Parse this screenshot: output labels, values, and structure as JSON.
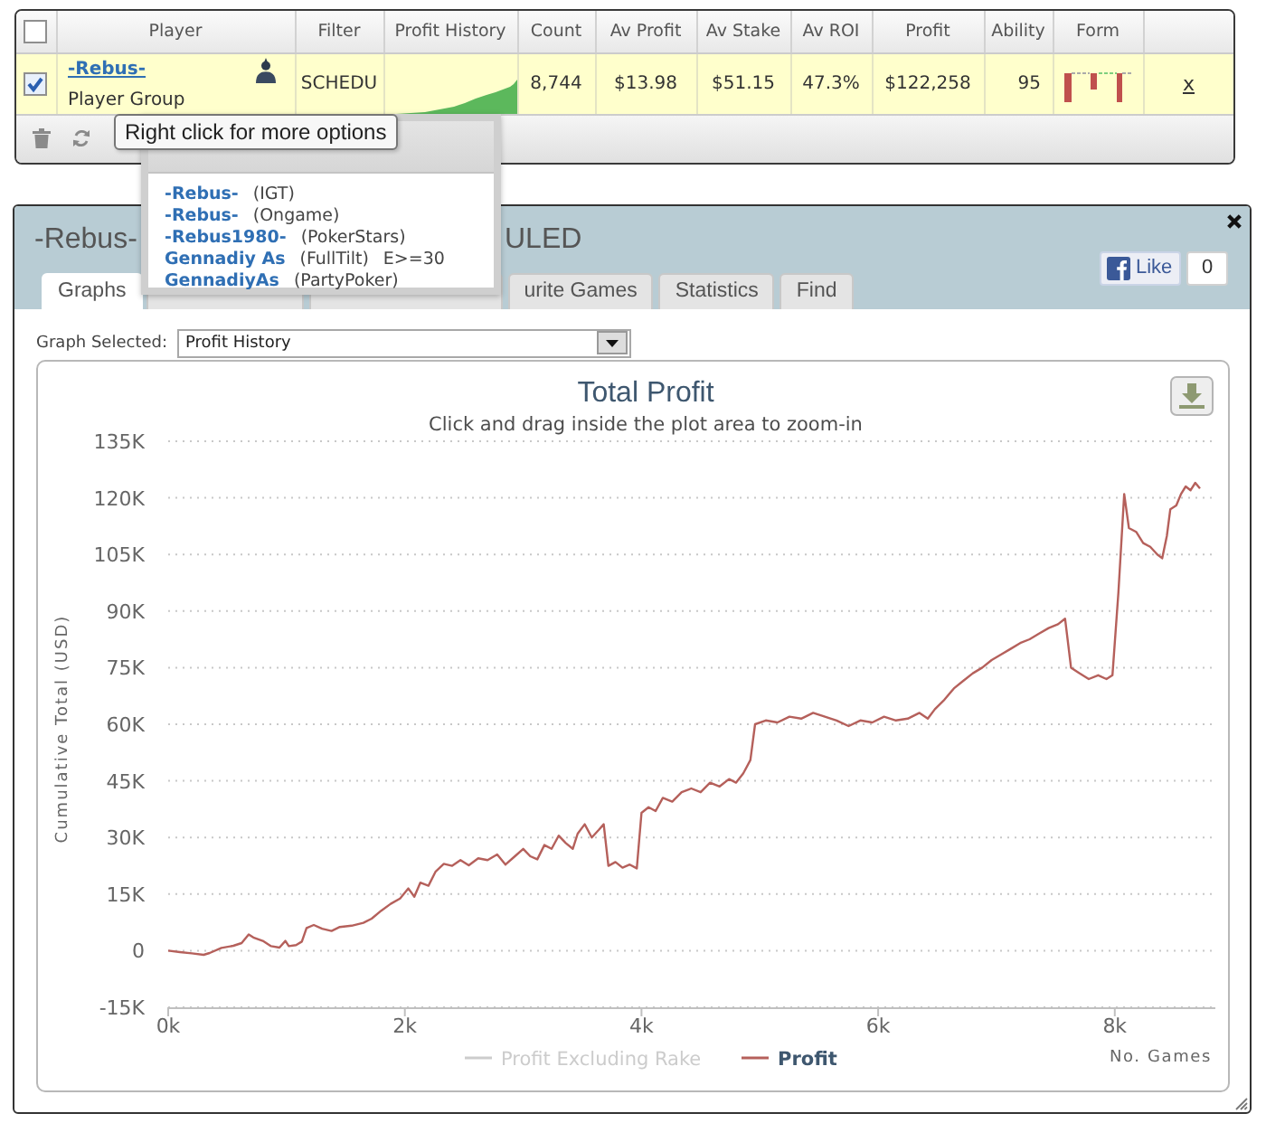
{
  "players_table": {
    "select_all_checked": false,
    "columns": [
      "Player",
      "Filter",
      "Profit History",
      "Count",
      "Av Profit",
      "Av Stake",
      "Av ROI",
      "Profit",
      "Ability",
      "Form"
    ],
    "rows": [
      {
        "checked": true,
        "player": "-Rebus-",
        "group": "Player Group",
        "filter": "SCHEDU",
        "count": "8,744",
        "av_profit": "$13.98",
        "av_stake": "$51.15",
        "av_roi": "47.3%",
        "profit": "$122,258",
        "ability": "95",
        "remove": "x"
      }
    ]
  },
  "tooltip": {
    "text": "Right click for more options"
  },
  "account_popup": {
    "accounts": [
      {
        "name": "-Rebus-",
        "site": "(IGT)"
      },
      {
        "name": "-Rebus-",
        "site": "(Ongame)"
      },
      {
        "name": "-Rebus1980-",
        "site": "(PokerStars)"
      },
      {
        "name": "Gennadiy As",
        "site": "(FullTilt)",
        "note": "E>=30"
      },
      {
        "name": "GennadiyAs",
        "site": "(PartyPoker)"
      }
    ]
  },
  "window": {
    "title_parts": [
      "-Rebus-",
      "ULED"
    ],
    "like": {
      "label": "Like",
      "count": "0"
    },
    "tabs": [
      {
        "label": "Graphs",
        "selected": true
      },
      {
        "selected": false
      },
      {
        "selected": false
      },
      {
        "label": "urite Games",
        "selected": false
      },
      {
        "label": "Statistics",
        "selected": false
      },
      {
        "label": "Find",
        "selected": false
      }
    ],
    "graph_select": {
      "label": "Graph Selected:",
      "value": "Profit History"
    },
    "chart": {
      "subtitle": "Click and drag inside the plot area to zoom-in",
      "legend": [
        {
          "label": "Profit Excluding Rake",
          "hidden": true
        }
      ],
      "chart_data": {
        "type": "line",
        "title": "Total Profit",
        "xlabel": "No. Games",
        "ylabel": "Cumulative Total (USD)",
        "grid": true,
        "x": [
          0,
          100,
          200,
          300,
          350,
          450,
          550,
          620,
          680,
          720,
          800,
          870,
          940,
          990,
          1020,
          1080,
          1130,
          1170,
          1230,
          1300,
          1380,
          1450,
          1550,
          1650,
          1720,
          1800,
          1880,
          1960,
          2030,
          2080,
          2130,
          2200,
          2260,
          2330,
          2400,
          2470,
          2540,
          2620,
          2700,
          2780,
          2850,
          2930,
          3000,
          3060,
          3120,
          3180,
          3240,
          3300,
          3360,
          3420,
          3460,
          3520,
          3580,
          3640,
          3680,
          3720,
          3780,
          3840,
          3900,
          3960,
          4000,
          4060,
          4120,
          4180,
          4260,
          4340,
          4420,
          4500,
          4580,
          4660,
          4740,
          4800,
          4860,
          4920,
          4960,
          5050,
          5150,
          5250,
          5350,
          5450,
          5550,
          5650,
          5750,
          5850,
          5950,
          6050,
          6150,
          6250,
          6350,
          6420,
          6480,
          6560,
          6640,
          6720,
          6800,
          6880,
          6960,
          7040,
          7120,
          7200,
          7280,
          7360,
          7440,
          7520,
          7580,
          7630,
          7700,
          7780,
          7860,
          7930,
          7980,
          8030,
          8080,
          8120,
          8180,
          8240,
          8300,
          8360,
          8400,
          8440,
          8470,
          8520,
          8560,
          8600,
          8640,
          8680,
          8720
        ],
        "series": [
          {
            "name": "Profit",
            "color": "#b5605b",
            "values": [
              0,
              -400,
              -700,
              -1100,
              -600,
              700,
              1300,
              2000,
              4300,
              3500,
              2600,
              1200,
              800,
              2600,
              1200,
              1500,
              2400,
              6000,
              6800,
              5800,
              5200,
              6300,
              6600,
              7400,
              8500,
              10600,
              12400,
              13800,
              16500,
              14300,
              18000,
              17200,
              21000,
              23000,
              22500,
              24000,
              22600,
              24500,
              24000,
              25500,
              22800,
              25000,
              27000,
              25000,
              24200,
              28000,
              27000,
              30500,
              28500,
              27000,
              31000,
              33500,
              30000,
              32000,
              33500,
              22500,
              23500,
              22000,
              22800,
              21800,
              36500,
              38000,
              37000,
              40500,
              39500,
              42000,
              43000,
              42000,
              44500,
              43500,
              45500,
              44500,
              47000,
              50500,
              60000,
              61000,
              60500,
              62000,
              61500,
              63000,
              62000,
              61000,
              59500,
              61000,
              60500,
              62000,
              61000,
              61500,
              63000,
              61500,
              64000,
              66500,
              69500,
              71500,
              73500,
              75000,
              77000,
              78500,
              80000,
              81500,
              82500,
              84000,
              85500,
              86500,
              88000,
              75000,
              73500,
              72000,
              73000,
              72000,
              73000,
              95000,
              121000,
              112000,
              111000,
              108000,
              107000,
              105000,
              104000,
              110000,
              117000,
              118000,
              121000,
              123000,
              122000,
              124000,
              122500
            ]
          }
        ],
        "xlim": [
          0,
          8850
        ],
        "ylim": [
          -15000,
          135000
        ],
        "xticks": [
          {
            "value": 0,
            "label": "0k"
          },
          {
            "value": 2000,
            "label": "2k"
          },
          {
            "value": 4000,
            "label": "4k"
          },
          {
            "value": 6000,
            "label": "6k"
          },
          {
            "value": 8000,
            "label": "8k"
          }
        ],
        "yticks": [
          {
            "value": -15000,
            "label": "-15K"
          },
          {
            "value": 0,
            "label": "0"
          },
          {
            "value": 15000,
            "label": "15K"
          },
          {
            "value": 30000,
            "label": "30K"
          },
          {
            "value": 45000,
            "label": "45K"
          },
          {
            "value": 60000,
            "label": "60K"
          },
          {
            "value": 75000,
            "label": "75K"
          },
          {
            "value": 90000,
            "label": "90K"
          },
          {
            "value": 105000,
            "label": "105K"
          },
          {
            "value": 120000,
            "label": "120K"
          },
          {
            "value": 135000,
            "label": "135K"
          }
        ]
      }
    }
  }
}
